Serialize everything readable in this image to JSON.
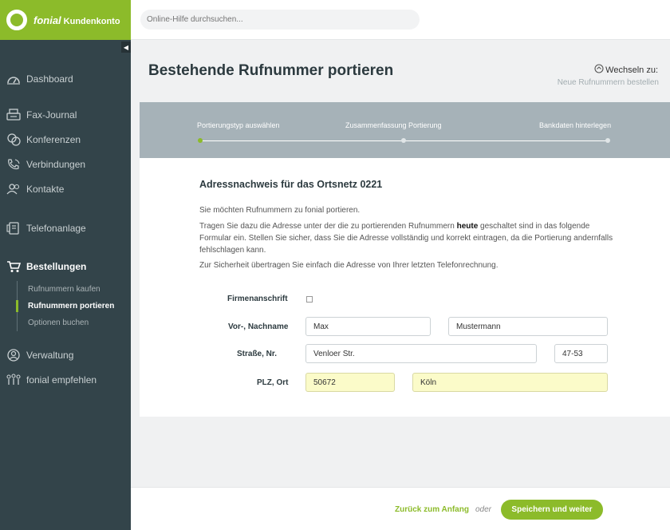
{
  "brand": {
    "name": "fonial",
    "subtitle": "Kundenkonto"
  },
  "search": {
    "placeholder": "Online-Hilfe durchsuchen..."
  },
  "sidebar": {
    "items": [
      {
        "label": "Dashboard",
        "icon": "dashboard-icon"
      },
      {
        "label": "Fax-Journal",
        "icon": "fax-icon"
      },
      {
        "label": "Konferenzen",
        "icon": "conference-icon"
      },
      {
        "label": "Verbindungen",
        "icon": "phone-icon"
      },
      {
        "label": "Kontakte",
        "icon": "contacts-icon"
      },
      {
        "label": "Telefonanlage",
        "icon": "phone-system-icon"
      },
      {
        "label": "Bestellungen",
        "icon": "cart-icon"
      },
      {
        "label": "Verwaltung",
        "icon": "user-icon"
      },
      {
        "label": "fonial empfehlen",
        "icon": "recommend-icon"
      }
    ],
    "subitems": [
      {
        "label": "Rufnummern kaufen"
      },
      {
        "label": "Rufnummern portieren"
      },
      {
        "label": "Optionen buchen"
      }
    ]
  },
  "page": {
    "title": "Bestehende Rufnummer portieren",
    "switch_label": "Wechseln zu:",
    "switch_link": "Neue Rufnummern bestellen"
  },
  "steps": [
    {
      "label": "Portierungstyp auswählen",
      "active": true
    },
    {
      "label": "Zusammenfassung Portierung",
      "active": false
    },
    {
      "label": "Bankdaten hinterlegen",
      "active": false
    }
  ],
  "content": {
    "section_title": "Adressnachweis für das Ortsnetz 0221",
    "p1": "Sie möchten Rufnummern zu fonial portieren.",
    "p2_a": "Tragen Sie dazu die Adresse unter der die zu portierenden Rufnummern ",
    "p2_bold": "heute",
    "p2_b": " geschaltet sind in das folgende Formular ein. Stellen Sie sicher, dass Sie die Adresse vollständig und korrekt eintragen, da die Portierung andernfalls fehlschlagen kann.",
    "p3": "Zur Sicherheit übertragen Sie einfach die Adresse von Ihrer letzten Telefonrechnung."
  },
  "form": {
    "company_label": "Firmenanschrift",
    "name_label": "Vor-, Nachname",
    "first_name": "Max",
    "last_name": "Mustermann",
    "street_label": "Straße, Nr.",
    "street": "Venloer Str.",
    "house_no": "47-53",
    "city_label": "PLZ, Ort",
    "zip": "50672",
    "city": "Köln"
  },
  "footer": {
    "back_label": "Zurück zum Anfang",
    "or_label": "oder",
    "save_label": "Speichern und weiter"
  },
  "colors": {
    "accent": "#8cbb2a",
    "sidebar": "#33444a",
    "stepper": "#a6b2b8",
    "highlight_field": "#fbfbc9"
  }
}
